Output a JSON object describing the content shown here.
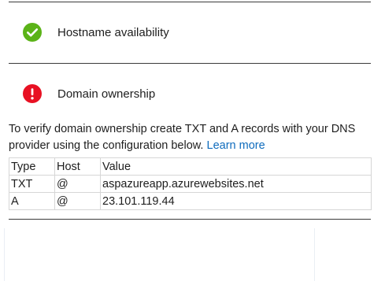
{
  "colors": {
    "success": "#5bb318",
    "error": "#e81123",
    "link": "#0f6cbd",
    "divider": "#3a3a3a"
  },
  "checks": [
    {
      "label": "Hostname availability",
      "status": "success",
      "icon": "check-circle-icon"
    },
    {
      "label": "Domain ownership",
      "status": "error",
      "icon": "error-circle-icon"
    }
  ],
  "ownership": {
    "description": "To verify domain ownership create TXT and A records with your DNS provider using the configuration below.",
    "learn_more": "Learn more"
  },
  "records": {
    "headers": [
      "Type",
      "Host",
      "Value"
    ],
    "rows": [
      [
        "TXT",
        "@",
        "aspazureapp.azurewebsites.net"
      ],
      [
        "A",
        "@",
        "23.101.119.44"
      ]
    ]
  }
}
